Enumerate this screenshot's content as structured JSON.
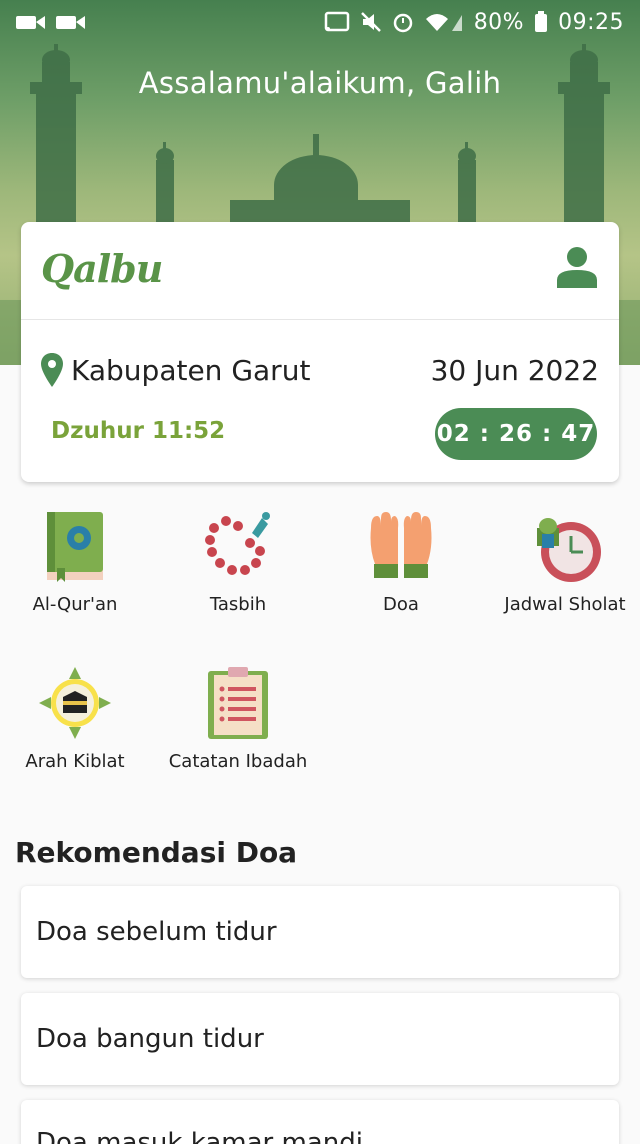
{
  "status_bar": {
    "battery": "80%",
    "time": "09:25"
  },
  "greeting": "Assalamu'alaikum, Galih",
  "app": {
    "logo": "Qalbu"
  },
  "location": {
    "name": "Kabupaten Garut",
    "date": "30 Jun 2022"
  },
  "prayer": {
    "next": "Dzuhur 11:52",
    "countdown": "02 : 26 : 47"
  },
  "menu": [
    {
      "label": "Al-Qur'an",
      "icon": "quran-book-icon"
    },
    {
      "label": "Tasbih",
      "icon": "prayer-beads-icon"
    },
    {
      "label": "Doa",
      "icon": "praying-hands-icon"
    },
    {
      "label": "Jadwal Sholat",
      "icon": "prayer-schedule-clock-icon"
    },
    {
      "label": "Arah Kiblat",
      "icon": "kaaba-compass-icon"
    },
    {
      "label": "Catatan Ibadah",
      "icon": "clipboard-notes-icon"
    }
  ],
  "recommendations": {
    "title": "Rekomendasi Doa",
    "items": [
      "Doa sebelum tidur",
      "Doa bangun tidur",
      "Doa masuk kamar mandi"
    ]
  },
  "colors": {
    "primary": "#4b8c55",
    "accent_text": "#7aa33a",
    "logo": "#5a9448"
  }
}
